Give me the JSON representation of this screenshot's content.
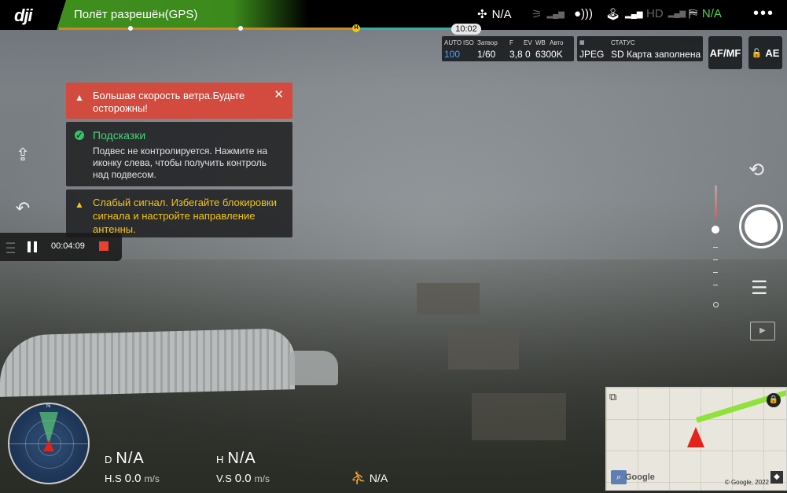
{
  "topbar": {
    "logo": "dji",
    "flight_status": "Полёт разрешён(GPS)",
    "drone_icon_value": "N/A",
    "gps_icon": "satellite-icon",
    "signal_value": "N/A",
    "more_icon": "more-icon"
  },
  "timeline": {
    "clock": "10:02"
  },
  "camera": {
    "labels": {
      "auto": "AUTO",
      "iso": "ISO",
      "shutter": "Затвор",
      "f": "F",
      "ev": "EV",
      "wb": "WB",
      "wb_mode": "Авто"
    },
    "iso": "100",
    "shutter": "1/60",
    "f": "3,8",
    "ev": "0",
    "wb": "6300K",
    "format": "JPEG",
    "status_label": "СТАТУС",
    "status_value": "SD Карта заполнена",
    "afmf": "AF/MF",
    "ae": "AE"
  },
  "notifications": {
    "wind": "Большая скорость ветра.Будьте осторожны!",
    "hint_title": "Подсказки",
    "hint_body": "Подвес не контролируется. Нажмите на иконку слева, чтобы получить контроль над подвесом.",
    "signal": "Слабый сигнал. Избегайте блокировки сигнала и настройте направление антенны."
  },
  "recording": {
    "time": "00:04:09"
  },
  "map": {
    "copyright": "© Google, 2022",
    "google": "Google"
  },
  "telemetry": {
    "d_label": "D",
    "d_value": "N/A",
    "h_label": "H",
    "h_value": "N/A",
    "hs_label": "H.S",
    "hs_value": "0.0",
    "hs_unit": "m/s",
    "vs_label": "V.S",
    "vs_value": "0.0",
    "vs_unit": "m/s",
    "rc_value": "N/A"
  },
  "colors": {
    "accent_green": "#3f8f1e",
    "warning_red": "#d6483a",
    "hint_green": "#47d37a",
    "signal_yellow": "#f5c518"
  }
}
